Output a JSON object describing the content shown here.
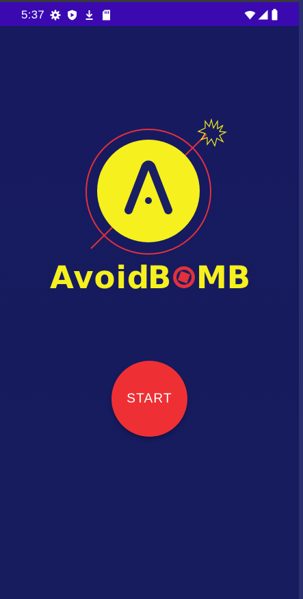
{
  "status_bar": {
    "time": "5:37",
    "icons_left": [
      "settings-icon",
      "shield-play-icon",
      "download-icon",
      "sd-card-icon"
    ],
    "icons_right": [
      "wifi-icon",
      "signal-icon",
      "battery-icon"
    ]
  },
  "logo": {
    "letter": "A",
    "title_part1": "Avoid",
    "title_part2": "B",
    "title_part3": "MB",
    "accent_yellow": "#f5f01e",
    "accent_red": "#e2313a"
  },
  "start_button": {
    "label": "START",
    "color": "#ee3035"
  },
  "colors": {
    "status_bar": "#3a0ab0",
    "background": "#161b5e"
  }
}
